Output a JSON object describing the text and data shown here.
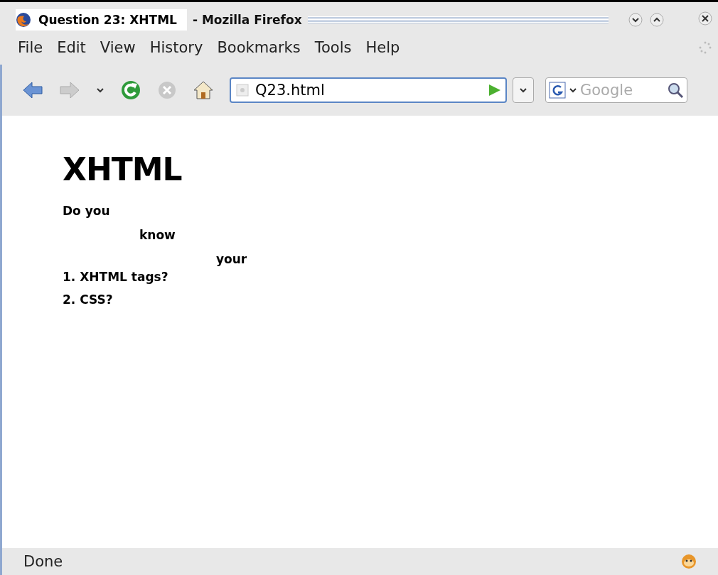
{
  "window": {
    "title": "Question 23: XHTML",
    "app_title": "- Mozilla Firefox"
  },
  "menu": [
    "File",
    "Edit",
    "View",
    "History",
    "Bookmarks",
    "Tools",
    "Help"
  ],
  "toolbar": {
    "forward_disabled": true,
    "address": "Q23.html",
    "search_placeholder": "Google"
  },
  "page": {
    "heading": "XHTML",
    "lines": [
      {
        "text": "Do you",
        "children": [
          {
            "text": "know",
            "children": [
              {
                "text": "your"
              }
            ]
          }
        ]
      }
    ],
    "list": [
      "1. XHTML tags?",
      "2. CSS?"
    ]
  },
  "status_bar": {
    "text": "Done"
  }
}
